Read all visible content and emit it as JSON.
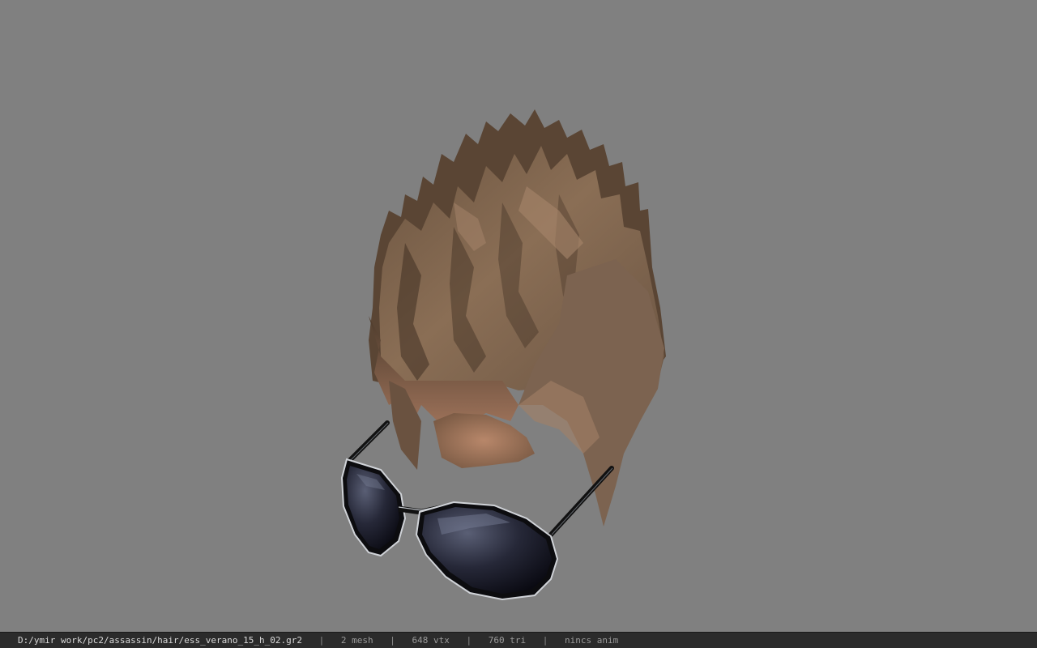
{
  "viewport": {
    "model": "hair-with-sunglasses",
    "background_color": "#808080"
  },
  "status_bar": {
    "file_path": "D:/ymir work/pc2/assassin/hair/ess_verano_15_h_02.gr2",
    "separator": "|",
    "mesh_count": "2 mesh",
    "vertex_count": "648 vtx",
    "triangle_count": "760 tri",
    "anim_status": "nincs anim"
  }
}
